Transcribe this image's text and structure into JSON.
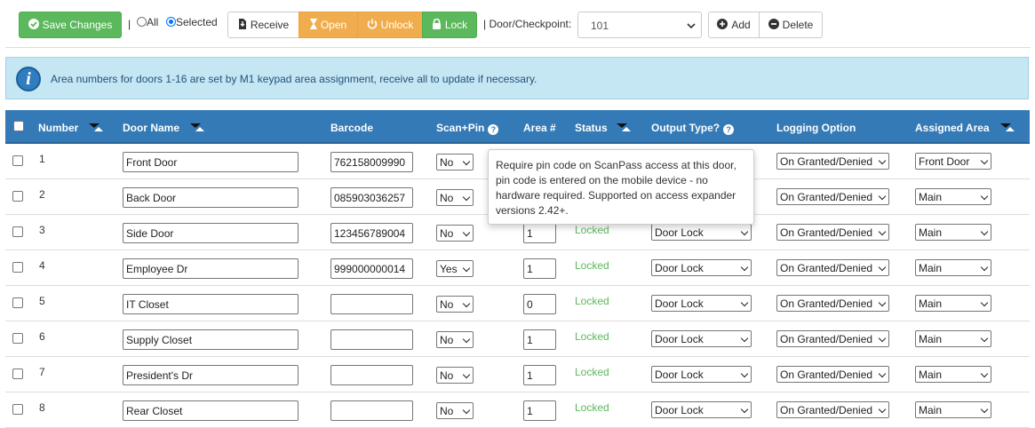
{
  "toolbar": {
    "save_label": "Save Changes",
    "pipe1": "|",
    "radio_all_label": "All",
    "radio_selected_label": "Selected",
    "receive_label": "Receive",
    "open_label": "Open",
    "unlock_label": "Unlock",
    "lock_label": "Lock",
    "door_checkpoint_label": "| Door/Checkpoint:",
    "door_value": "101",
    "add_label": "Add",
    "delete_label": "Delete"
  },
  "info": {
    "text": "Area numbers for doors 1-16 are set by M1 keypad area assignment, receive all to update if necessary."
  },
  "table": {
    "headers": {
      "number": "Number",
      "door_name": "Door Name",
      "barcode": "Barcode",
      "scan_pin": "Scan+Pin",
      "area": "Area #",
      "status": "Status",
      "output_type": "Output Type?",
      "logging_option": "Logging Option",
      "assigned_area": "Assigned Area"
    },
    "rows": [
      {
        "number": "1",
        "name": "Front Door",
        "barcode": "762158009990",
        "scan_pin": "No",
        "area": "",
        "status": "",
        "output": "",
        "logging": "On Granted/Denied",
        "assigned": "Front Door"
      },
      {
        "number": "2",
        "name": "Back Door",
        "barcode": "085903036257",
        "scan_pin": "No",
        "area": "",
        "status": "",
        "output": "",
        "logging": "On Granted/Denied",
        "assigned": "Main"
      },
      {
        "number": "3",
        "name": "Side Door",
        "barcode": "123456789004",
        "scan_pin": "No",
        "area": "1",
        "status": "Locked",
        "output": "Door Lock",
        "logging": "On Granted/Denied",
        "assigned": "Main"
      },
      {
        "number": "4",
        "name": "Employee Dr",
        "barcode": "999000000014",
        "scan_pin": "Yes",
        "area": "1",
        "status": "Locked",
        "output": "Door Lock",
        "logging": "On Granted/Denied",
        "assigned": "Main"
      },
      {
        "number": "5",
        "name": "IT Closet",
        "barcode": "",
        "scan_pin": "No",
        "area": "0",
        "status": "Locked",
        "output": "Door Lock",
        "logging": "On Granted/Denied",
        "assigned": "Main"
      },
      {
        "number": "6",
        "name": "Supply Closet",
        "barcode": "",
        "scan_pin": "No",
        "area": "1",
        "status": "Locked",
        "output": "Door Lock",
        "logging": "On Granted/Denied",
        "assigned": "Main"
      },
      {
        "number": "7",
        "name": "President's Dr",
        "barcode": "",
        "scan_pin": "No",
        "area": "1",
        "status": "Locked",
        "output": "Door Lock",
        "logging": "On Granted/Denied",
        "assigned": "Main"
      },
      {
        "number": "8",
        "name": "Rear Closet",
        "barcode": "",
        "scan_pin": "No",
        "area": "1",
        "status": "Locked",
        "output": "Door Lock",
        "logging": "On Granted/Denied",
        "assigned": "Main"
      }
    ]
  },
  "tooltip": {
    "text": "Require pin code on ScanPass access at this door, pin code is entered on the mobile device - no hardware required. Supported on access expander versions 2.42+."
  },
  "colors": {
    "save": "#5cb85c",
    "lock": "#5cb85c",
    "open_unlock": "#f0ad4e",
    "header": "#337ab7",
    "info_bg": "#c5e6f3",
    "status_locked": "#5cb85c"
  }
}
